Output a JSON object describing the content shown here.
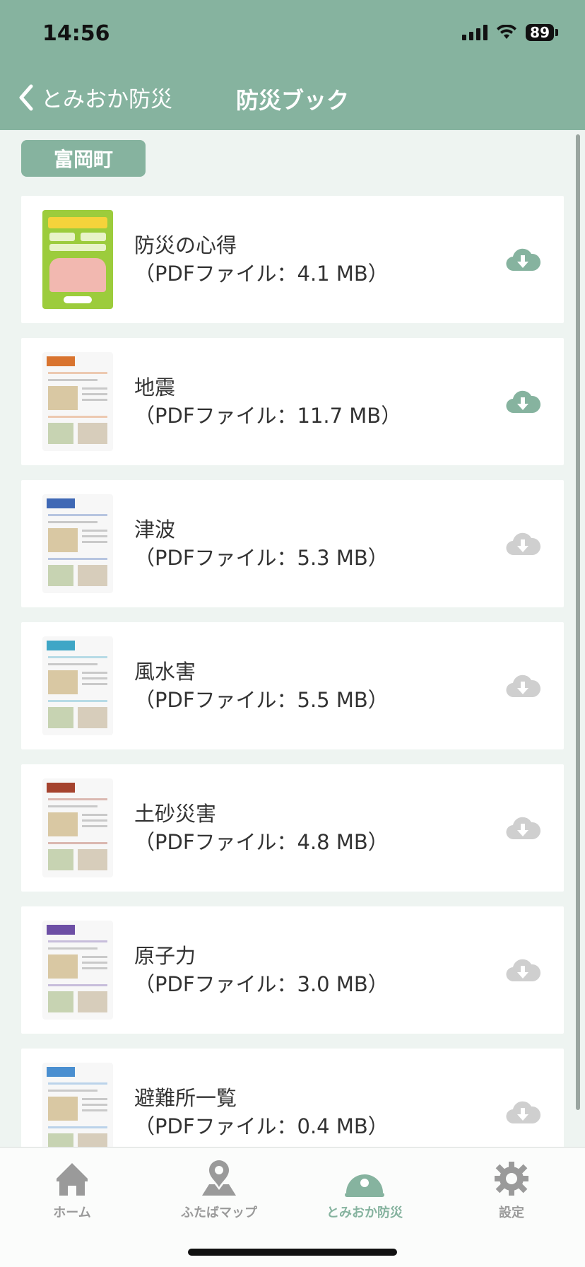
{
  "status_bar": {
    "time": "14:56",
    "battery": "89"
  },
  "nav": {
    "back_label": "とみおか防災",
    "title": "防災ブック"
  },
  "section": {
    "tag": "富岡町"
  },
  "books": [
    {
      "title": "防災の心得",
      "file": "（PDFファイル：4.1 MB）",
      "downloaded": true,
      "thumb_color": "#9ccc3c"
    },
    {
      "title": "地震",
      "file": "（PDFファイル：11.7 MB）",
      "downloaded": true,
      "thumb_color": "#d9742f"
    },
    {
      "title": "津波",
      "file": "（PDFファイル：5.3 MB）",
      "downloaded": false,
      "thumb_color": "#3f68b5"
    },
    {
      "title": "風水害",
      "file": "（PDFファイル：5.5 MB）",
      "downloaded": false,
      "thumb_color": "#3fa6c6"
    },
    {
      "title": "土砂災害",
      "file": "（PDFファイル：4.8 MB）",
      "downloaded": false,
      "thumb_color": "#a5432e"
    },
    {
      "title": "原子力",
      "file": "（PDFファイル：3.0 MB）",
      "downloaded": false,
      "thumb_color": "#6d4fa5"
    },
    {
      "title": "避難所一覧",
      "file": "（PDFファイル：0.4 MB）",
      "downloaded": false,
      "thumb_color": "#4a8fd0"
    }
  ],
  "tabs": [
    {
      "label": "ホーム",
      "icon": "home-icon",
      "active": false
    },
    {
      "label": "ふたばマップ",
      "icon": "map-pin-icon",
      "active": false
    },
    {
      "label": "とみおか防災",
      "icon": "helmet-icon",
      "active": true
    },
    {
      "label": "設定",
      "icon": "gear-icon",
      "active": false
    }
  ],
  "colors": {
    "accent": "#86b39f",
    "download_active": "#86b39f",
    "download_inactive": "#cfcfcf"
  }
}
